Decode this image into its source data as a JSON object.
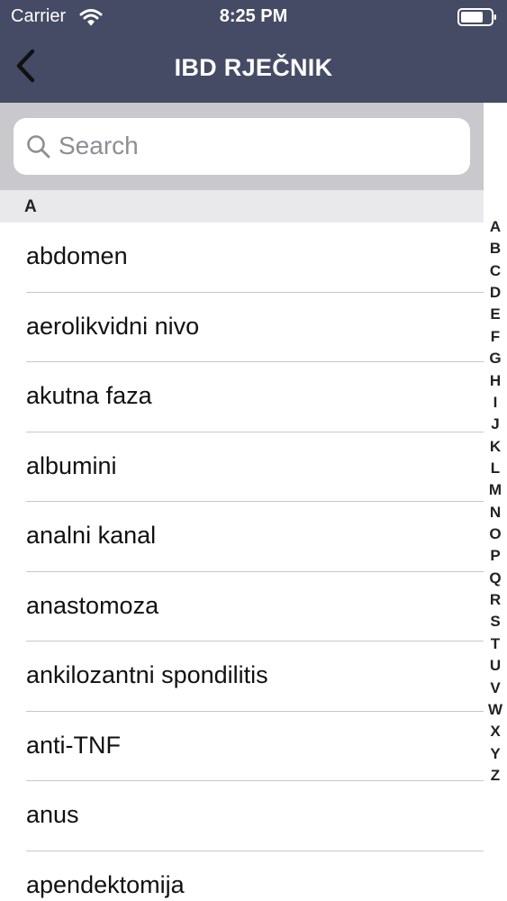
{
  "status_bar": {
    "carrier": "Carrier",
    "time": "8:25 PM"
  },
  "nav": {
    "title": "IBD RJEČNIK",
    "back_icon": "chevron-left-icon"
  },
  "search": {
    "placeholder": "Search",
    "value": "",
    "icon": "search-icon"
  },
  "section": {
    "letter": "A"
  },
  "items": [
    {
      "label": "abdomen"
    },
    {
      "label": "aerolikvidni nivo"
    },
    {
      "label": "akutna faza"
    },
    {
      "label": "albumini"
    },
    {
      "label": "analni kanal"
    },
    {
      "label": "anastomoza"
    },
    {
      "label": "ankilozantni spondilitis"
    },
    {
      "label": "anti-TNF"
    },
    {
      "label": "anus"
    },
    {
      "label": "apendektomija"
    }
  ],
  "index": [
    "A",
    "B",
    "C",
    "D",
    "E",
    "F",
    "G",
    "H",
    "I",
    "J",
    "K",
    "L",
    "M",
    "N",
    "O",
    "P",
    "Q",
    "R",
    "S",
    "T",
    "U",
    "V",
    "W",
    "X",
    "Y",
    "Z"
  ],
  "colors": {
    "nav_background": "#454b64",
    "search_background": "#c8c8cd",
    "section_background": "#e9e9ec"
  }
}
